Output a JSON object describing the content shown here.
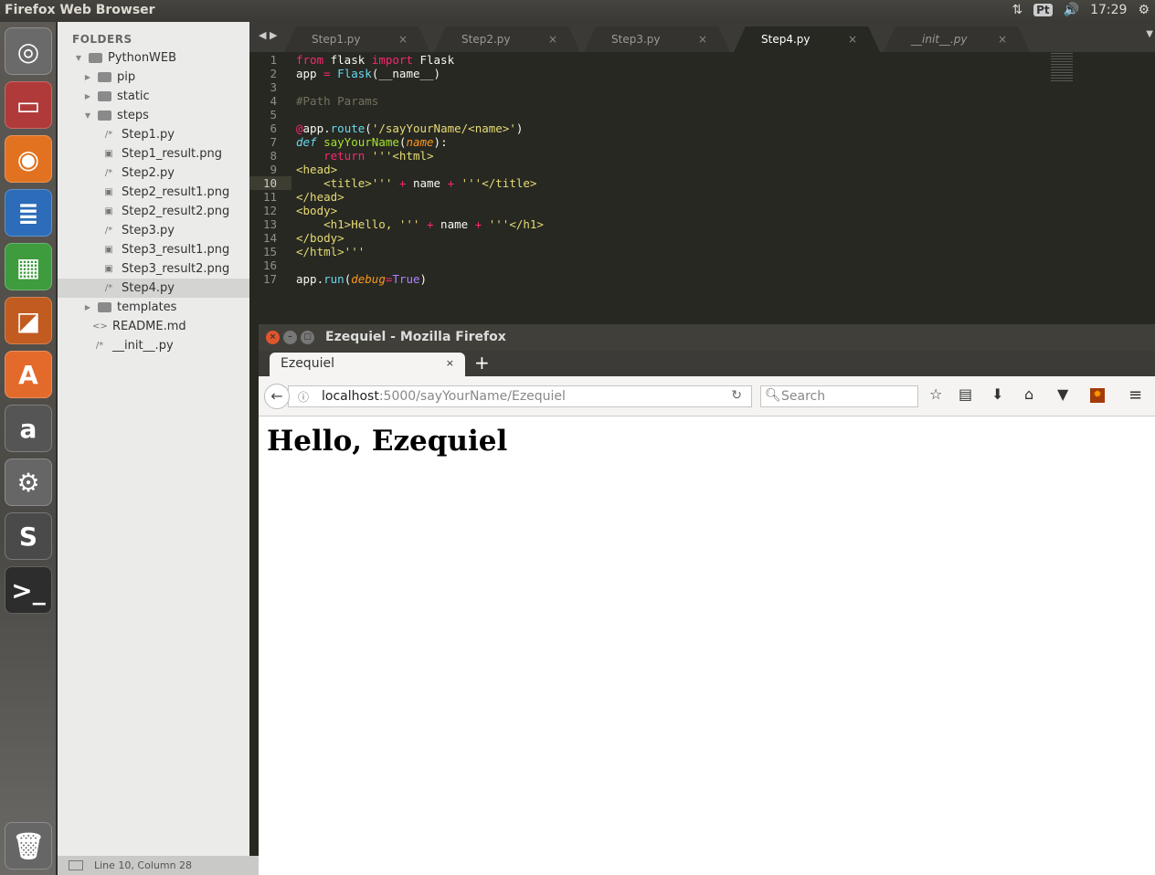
{
  "panel": {
    "title": "Firefox Web Browser",
    "indicator": "Pt",
    "volume": "🔊",
    "time": "17:29"
  },
  "launcher": [
    {
      "name": "dash",
      "glyph": "◎",
      "color": "#6a6a6a"
    },
    {
      "name": "files",
      "glyph": "▭",
      "color": "#b03a3a"
    },
    {
      "name": "firefox",
      "glyph": "◉",
      "color": "#e2721f"
    },
    {
      "name": "writer",
      "glyph": "≣",
      "color": "#2c6cb8"
    },
    {
      "name": "calc",
      "glyph": "▦",
      "color": "#3e9b3e"
    },
    {
      "name": "impress",
      "glyph": "◪",
      "color": "#c25b1f"
    },
    {
      "name": "software-center",
      "glyph": "A",
      "color": "#e36a2b"
    },
    {
      "name": "amazon",
      "glyph": "a",
      "color": "#555"
    },
    {
      "name": "settings",
      "glyph": "⚙",
      "color": "#666"
    },
    {
      "name": "sublime",
      "glyph": "S",
      "color": "#4a4a4a"
    },
    {
      "name": "terminal",
      "glyph": ">_",
      "color": "#2d2d2d"
    }
  ],
  "trash": "🗑",
  "sidebar": {
    "header": "FOLDERS",
    "items": [
      {
        "label": "PythonWEB",
        "type": "folder-open",
        "depth": 0
      },
      {
        "label": "pip",
        "type": "folder",
        "depth": 1
      },
      {
        "label": "static",
        "type": "folder",
        "depth": 1
      },
      {
        "label": "steps",
        "type": "folder-open",
        "depth": 1
      },
      {
        "label": "Step1.py",
        "type": "py",
        "depth": 2
      },
      {
        "label": "Step1_result.png",
        "type": "img",
        "depth": 2
      },
      {
        "label": "Step2.py",
        "type": "py",
        "depth": 2
      },
      {
        "label": "Step2_result1.png",
        "type": "img",
        "depth": 2
      },
      {
        "label": "Step2_result2.png",
        "type": "img",
        "depth": 2
      },
      {
        "label": "Step3.py",
        "type": "py",
        "depth": 2
      },
      {
        "label": "Step3_result1.png",
        "type": "img",
        "depth": 2
      },
      {
        "label": "Step3_result2.png",
        "type": "img",
        "depth": 2
      },
      {
        "label": "Step4.py",
        "type": "py",
        "depth": 2,
        "selected": true
      },
      {
        "label": "templates",
        "type": "folder",
        "depth": 1
      },
      {
        "label": "README.md",
        "type": "md",
        "depth": 1
      },
      {
        "label": "__init__.py",
        "type": "py",
        "depth": 1
      }
    ]
  },
  "status": "Line 10, Column 28",
  "editor": {
    "tabs": [
      "Step1.py",
      "Step2.py",
      "Step3.py",
      "Step4.py",
      "__init__.py"
    ],
    "active_tab": 3,
    "current_line": 10,
    "lines": [
      [
        [
          "from",
          "kw"
        ],
        [
          " flask ",
          ""
        ],
        [
          "import",
          "kw"
        ],
        [
          " Flask",
          ""
        ]
      ],
      [
        [
          "app ",
          ""
        ],
        [
          "=",
          "kw"
        ],
        [
          " ",
          ""
        ],
        [
          "Flask",
          "bi"
        ],
        [
          "(__name__)",
          ""
        ]
      ],
      [],
      [
        [
          "#Path Params",
          "cm"
        ]
      ],
      [],
      [
        [
          "@",
          "kw"
        ],
        [
          "app.",
          ""
        ],
        [
          "route",
          "bi"
        ],
        [
          "(",
          ""
        ],
        [
          "'/sayYourName/<name>'",
          "st"
        ],
        [
          ")",
          ""
        ]
      ],
      [
        [
          "def",
          "df"
        ],
        [
          " ",
          ""
        ],
        [
          "sayYourName",
          "fn"
        ],
        [
          "(",
          ""
        ],
        [
          "name",
          "it"
        ],
        [
          "):",
          ""
        ]
      ],
      [
        [
          "    ",
          ""
        ],
        [
          "return",
          "kw"
        ],
        [
          " '''<html>",
          "st"
        ]
      ],
      [
        [
          "<head>",
          "st"
        ]
      ],
      [
        [
          "    <title>'''",
          "st"
        ],
        [
          " ",
          ""
        ],
        [
          "+",
          "kw"
        ],
        [
          " name ",
          ""
        ],
        [
          "+",
          "kw"
        ],
        [
          " '''</title>",
          "st"
        ]
      ],
      [
        [
          "</head>",
          "st"
        ]
      ],
      [
        [
          "<body>",
          "st"
        ]
      ],
      [
        [
          "    <h1>Hello, '''",
          "st"
        ],
        [
          " ",
          ""
        ],
        [
          "+",
          "kw"
        ],
        [
          " name ",
          ""
        ],
        [
          "+",
          "kw"
        ],
        [
          " '''</h1>",
          "st"
        ]
      ],
      [
        [
          "</body>",
          "st"
        ]
      ],
      [
        [
          "</html>'''",
          "st"
        ]
      ],
      [],
      [
        [
          "app.",
          ""
        ],
        [
          "run",
          "bi"
        ],
        [
          "(",
          ""
        ],
        [
          "debug",
          "it"
        ],
        [
          "=",
          "kw"
        ],
        [
          "True",
          "cn"
        ],
        [
          ")",
          ""
        ]
      ]
    ]
  },
  "firefox": {
    "window_title": "Ezequiel - Mozilla Firefox",
    "tab_title": "Ezequiel",
    "tab_close": "×",
    "new_tab": "+",
    "url_host": "localhost",
    "url_rest": ":5000/sayYourName/Ezequiel",
    "search_placeholder": "Search",
    "page_heading": "Hello, Ezequiel"
  }
}
